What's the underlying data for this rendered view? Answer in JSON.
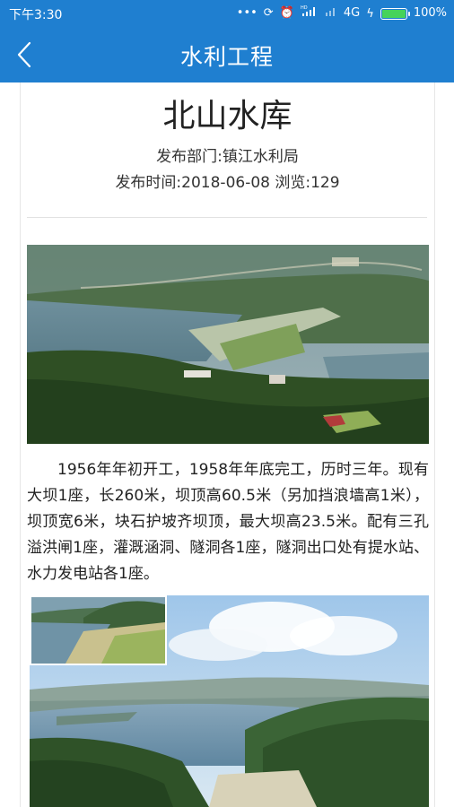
{
  "status_bar": {
    "time": "下午3:30",
    "network": "4G",
    "battery_percent": "100%",
    "battery_level": 1.0,
    "icons": [
      "more-dots-icon",
      "sync-icon",
      "alarm-icon",
      "hd-signal-icon",
      "signal-icon",
      "charging-icon",
      "battery-icon"
    ]
  },
  "header": {
    "title": "水利工程",
    "back_icon": "chevron-left-icon",
    "background_color": "#1f7fd0"
  },
  "article": {
    "title": "北山水库",
    "department": "发布部门:镇江水利局",
    "publish_info": "发布时间:2018-06-08 浏览:129",
    "body": "1956年年初开工，1958年年底完工，历时三年。现有大坝1座，长260米，坝顶高60.5米（另加挡浪墙高1米），坝顶宽6米，块石护坡齐坝顶，最大坝高23.5米。配有三孔溢洪闸1座，灌溉涵洞、隧洞各1座，隧洞出口处有提水站、水力发电站各1座。"
  },
  "images": [
    {
      "name": "reservoir-aerial-photo-1"
    },
    {
      "name": "reservoir-aerial-photo-2"
    }
  ]
}
